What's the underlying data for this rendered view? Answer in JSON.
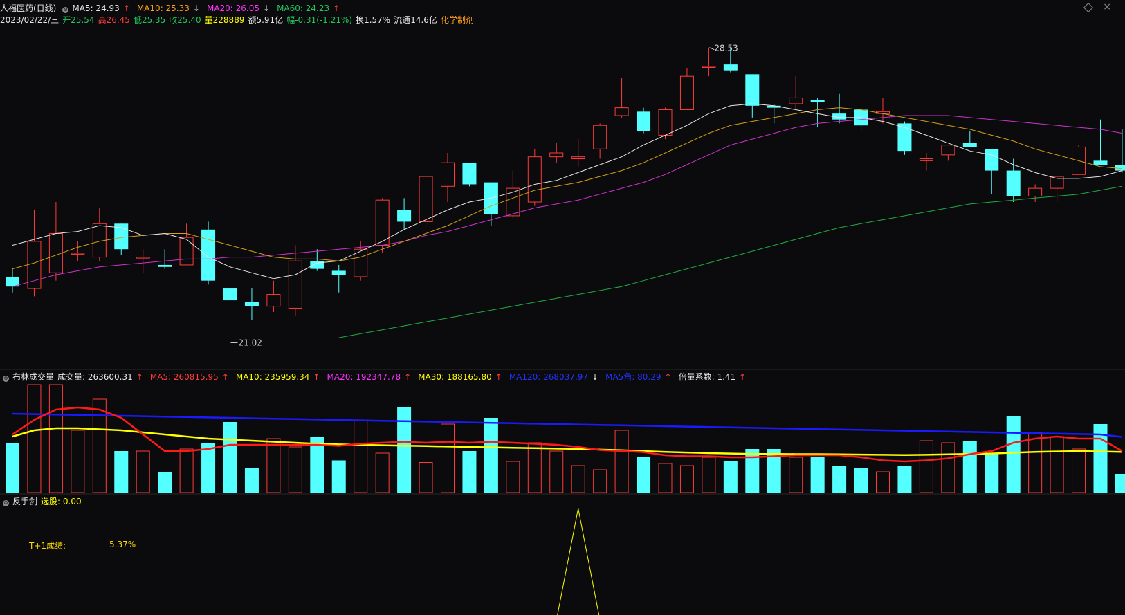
{
  "header": {
    "name": "人福医药(日线)",
    "ma5": "MA5: 24.93",
    "ma5_arrow": "↑",
    "ma10": "MA10: 25.33",
    "ma10_arrow": "↓",
    "ma20": "MA20: 26.05",
    "ma20_arrow": "↓",
    "ma60": "MA60: 24.23",
    "ma60_arrow": "↑",
    "date": "2023/02/22/三",
    "open": "开25.54",
    "high": "高26.45",
    "low": "低25.35",
    "close": "收25.40",
    "volume": "量228889",
    "amount": "额5.91亿",
    "change": "幅-0.31(-1.21%)",
    "turnover": "换1.57%",
    "float": "流通14.6亿",
    "sector": "化学制剂"
  },
  "volume_header": {
    "name": "布林成交量",
    "vol": "成交量: 263600.31",
    "vol_arrow": "↑",
    "ma5": "MA5: 260815.95",
    "ma5_arrow": "↑",
    "ma10": "MA10: 235959.34",
    "ma10_arrow": "↑",
    "ma20": "MA20: 192347.78",
    "ma20_arrow": "↑",
    "ma30": "MA30: 188165.80",
    "ma30_arrow": "↑",
    "ma120": "MA120: 268037.97",
    "ma120_arrow": "↓",
    "ma5angle": "MA5角: 80.29",
    "ma5angle_arrow": "↑",
    "ratio": "倍量系数: 1.41",
    "ratio_arrow": "↑"
  },
  "indicator_header": {
    "name": "反手剑",
    "pick": "选股: 0.00"
  },
  "stats": {
    "t1_label": "T+1成绩:",
    "t1_value": "5.37%"
  },
  "annotations": {
    "high_label": "28.53",
    "low_label": "21.02"
  },
  "colors": {
    "up": "#ff3b3b",
    "down": "#54ffff",
    "ma5": "#e6e6e6",
    "ma10": "#d4a017",
    "ma20": "#cc33cc",
    "ma60": "#22aa44",
    "vol_ma5": "#ff1a1a",
    "vol_ma10": "#ffff00",
    "vol_ma20": "#cc33cc",
    "vol_ma120": "#1a1aff",
    "signal": "#ffff00"
  },
  "chart_data": [
    {
      "type": "candlestick",
      "y_range": [
        20.5,
        29.0
      ],
      "candles": [
        {
          "o": 22.7,
          "h": 22.9,
          "l": 22.3,
          "c": 22.45
        },
        {
          "o": 22.4,
          "h": 24.4,
          "l": 22.2,
          "c": 23.6
        },
        {
          "o": 22.8,
          "h": 24.6,
          "l": 22.6,
          "c": 23.8
        },
        {
          "o": 23.3,
          "h": 23.6,
          "l": 23.1,
          "c": 23.3
        },
        {
          "o": 23.2,
          "h": 24.45,
          "l": 23.1,
          "c": 24.05
        },
        {
          "o": 24.05,
          "h": 24.05,
          "l": 23.25,
          "c": 23.4
        },
        {
          "o": 23.2,
          "h": 23.4,
          "l": 22.8,
          "c": 23.2
        },
        {
          "o": 23.0,
          "h": 23.4,
          "l": 22.9,
          "c": 22.95
        },
        {
          "o": 23.0,
          "h": 24.05,
          "l": 23.0,
          "c": 23.7
        },
        {
          "o": 23.9,
          "h": 24.1,
          "l": 22.5,
          "c": 22.6
        },
        {
          "o": 22.4,
          "h": 22.7,
          "l": 21.02,
          "c": 22.1
        },
        {
          "o": 22.05,
          "h": 22.4,
          "l": 21.6,
          "c": 21.95
        },
        {
          "o": 21.95,
          "h": 22.6,
          "l": 21.8,
          "c": 22.25
        },
        {
          "o": 21.9,
          "h": 23.5,
          "l": 21.7,
          "c": 23.1
        },
        {
          "o": 23.1,
          "h": 23.4,
          "l": 22.85,
          "c": 22.9
        },
        {
          "o": 22.85,
          "h": 23.0,
          "l": 22.3,
          "c": 22.75
        },
        {
          "o": 22.7,
          "h": 23.6,
          "l": 22.6,
          "c": 23.4
        },
        {
          "o": 23.5,
          "h": 24.7,
          "l": 23.3,
          "c": 24.65
        },
        {
          "o": 24.4,
          "h": 24.7,
          "l": 23.9,
          "c": 24.1
        },
        {
          "o": 24.1,
          "h": 25.35,
          "l": 23.95,
          "c": 25.25
        },
        {
          "o": 25.0,
          "h": 25.85,
          "l": 24.6,
          "c": 25.6
        },
        {
          "o": 25.6,
          "h": 25.6,
          "l": 25.0,
          "c": 25.05
        },
        {
          "o": 25.1,
          "h": 25.1,
          "l": 24.0,
          "c": 24.3
        },
        {
          "o": 24.25,
          "h": 25.4,
          "l": 24.2,
          "c": 24.95
        },
        {
          "o": 24.6,
          "h": 25.95,
          "l": 24.5,
          "c": 25.75
        },
        {
          "o": 25.75,
          "h": 26.1,
          "l": 25.6,
          "c": 25.85
        },
        {
          "o": 25.7,
          "h": 26.2,
          "l": 25.5,
          "c": 25.75
        },
        {
          "o": 25.95,
          "h": 26.6,
          "l": 25.7,
          "c": 26.55
        },
        {
          "o": 26.8,
          "h": 27.75,
          "l": 26.75,
          "c": 27.0
        },
        {
          "o": 26.9,
          "h": 27.0,
          "l": 26.35,
          "c": 26.4
        },
        {
          "o": 26.3,
          "h": 27.0,
          "l": 26.2,
          "c": 26.95
        },
        {
          "o": 26.95,
          "h": 28.0,
          "l": 26.95,
          "c": 27.8
        },
        {
          "o": 28.05,
          "h": 28.53,
          "l": 27.8,
          "c": 28.05
        },
        {
          "o": 28.1,
          "h": 28.53,
          "l": 27.9,
          "c": 27.95
        },
        {
          "o": 27.85,
          "h": 27.85,
          "l": 26.75,
          "c": 27.05
        },
        {
          "o": 27.05,
          "h": 27.1,
          "l": 26.6,
          "c": 27.0
        },
        {
          "o": 27.1,
          "h": 27.8,
          "l": 26.95,
          "c": 27.25
        },
        {
          "o": 27.2,
          "h": 27.25,
          "l": 26.5,
          "c": 27.15
        },
        {
          "o": 26.85,
          "h": 27.35,
          "l": 26.6,
          "c": 26.7
        },
        {
          "o": 26.95,
          "h": 27.0,
          "l": 26.4,
          "c": 26.55
        },
        {
          "o": 26.85,
          "h": 27.25,
          "l": 26.6,
          "c": 26.9
        },
        {
          "o": 26.6,
          "h": 26.65,
          "l": 25.8,
          "c": 25.9
        },
        {
          "o": 25.65,
          "h": 25.85,
          "l": 25.4,
          "c": 25.7
        },
        {
          "o": 25.8,
          "h": 26.0,
          "l": 25.65,
          "c": 26.05
        },
        {
          "o": 26.1,
          "h": 26.4,
          "l": 26.0,
          "c": 26.0
        },
        {
          "o": 25.95,
          "h": 25.95,
          "l": 24.8,
          "c": 25.4
        },
        {
          "o": 25.4,
          "h": 25.7,
          "l": 24.6,
          "c": 24.75
        },
        {
          "o": 24.75,
          "h": 25.05,
          "l": 24.6,
          "c": 24.95
        },
        {
          "o": 24.95,
          "h": 25.2,
          "l": 24.6,
          "c": 25.25
        },
        {
          "o": 25.3,
          "h": 26.05,
          "l": 25.3,
          "c": 26.0
        },
        {
          "o": 25.65,
          "h": 26.7,
          "l": 25.55,
          "c": 25.55
        },
        {
          "o": 25.54,
          "h": 26.45,
          "l": 25.35,
          "c": 25.4
        }
      ],
      "ma5": [
        23.5,
        23.65,
        23.8,
        23.85,
        24.0,
        23.95,
        23.75,
        23.8,
        23.65,
        23.2,
        22.95,
        22.8,
        22.65,
        22.75,
        23.05,
        23.1,
        23.35,
        23.6,
        23.9,
        24.15,
        24.4,
        24.6,
        24.7,
        24.85,
        25.05,
        25.15,
        25.35,
        25.55,
        25.75,
        26.05,
        26.3,
        26.55,
        26.85,
        27.05,
        27.1,
        27.05,
        26.95,
        26.85,
        26.75,
        26.75,
        26.65,
        26.5,
        26.3,
        26.1,
        25.9,
        25.8,
        25.55,
        25.35,
        25.2,
        25.2,
        25.25,
        25.4
      ],
      "ma10": [
        22.9,
        23.05,
        23.25,
        23.45,
        23.6,
        23.7,
        23.75,
        23.8,
        23.8,
        23.65,
        23.5,
        23.35,
        23.2,
        23.15,
        23.15,
        23.1,
        23.2,
        23.4,
        23.6,
        23.8,
        24.0,
        24.25,
        24.5,
        24.7,
        24.9,
        25.0,
        25.1,
        25.25,
        25.4,
        25.6,
        25.85,
        26.1,
        26.35,
        26.55,
        26.65,
        26.75,
        26.85,
        26.95,
        27.0,
        26.95,
        26.85,
        26.75,
        26.65,
        26.55,
        26.45,
        26.3,
        26.15,
        25.95,
        25.8,
        25.65,
        25.5,
        25.45
      ],
      "ma20": [
        22.45,
        22.6,
        22.75,
        22.85,
        22.95,
        23.0,
        23.05,
        23.1,
        23.15,
        23.15,
        23.2,
        23.2,
        23.25,
        23.3,
        23.35,
        23.4,
        23.45,
        23.5,
        23.6,
        23.75,
        23.85,
        24.0,
        24.15,
        24.3,
        24.45,
        24.55,
        24.65,
        24.8,
        24.95,
        25.1,
        25.3,
        25.55,
        25.8,
        26.05,
        26.2,
        26.35,
        26.5,
        26.6,
        26.65,
        26.7,
        26.75,
        26.8,
        26.8,
        26.8,
        26.75,
        26.7,
        26.65,
        26.6,
        26.55,
        26.5,
        26.45,
        26.35
      ],
      "ma60": [
        null,
        null,
        null,
        null,
        null,
        null,
        null,
        null,
        null,
        null,
        null,
        null,
        null,
        null,
        null,
        21.15,
        21.25,
        21.35,
        21.45,
        21.55,
        21.65,
        21.75,
        21.85,
        21.95,
        22.05,
        22.15,
        22.25,
        22.35,
        22.45,
        22.6,
        22.75,
        22.9,
        23.05,
        23.2,
        23.35,
        23.5,
        23.65,
        23.8,
        23.95,
        24.05,
        24.15,
        24.25,
        24.35,
        24.45,
        24.55,
        24.6,
        24.65,
        24.7,
        24.75,
        24.8,
        24.9,
        25.0
      ]
    },
    {
      "type": "bar",
      "name": "布林成交量",
      "y_range": [
        0,
        520000
      ],
      "volumes": [
        240000,
        520000,
        520000,
        300000,
        450000,
        200000,
        200000,
        100000,
        210000,
        240000,
        340000,
        120000,
        260000,
        220000,
        270000,
        155000,
        350000,
        190000,
        410000,
        145000,
        330000,
        200000,
        360000,
        150000,
        240000,
        200000,
        130000,
        110000,
        300000,
        170000,
        140000,
        130000,
        170000,
        150000,
        210000,
        210000,
        170000,
        170000,
        130000,
        120000,
        100000,
        130000,
        250000,
        240000,
        250000,
        190000,
        370000,
        290000,
        270000,
        210000,
        330000,
        90000
      ],
      "ma5": [
        280000,
        350000,
        400000,
        410000,
        400000,
        360000,
        280000,
        200000,
        200000,
        210000,
        230000,
        230000,
        230000,
        230000,
        230000,
        225000,
        235000,
        240000,
        245000,
        240000,
        245000,
        240000,
        245000,
        240000,
        235000,
        230000,
        220000,
        205000,
        200000,
        195000,
        180000,
        175000,
        175000,
        170000,
        170000,
        175000,
        180000,
        180000,
        180000,
        170000,
        155000,
        150000,
        155000,
        165000,
        185000,
        200000,
        240000,
        260000,
        270000,
        260000,
        260000,
        200000
      ],
      "ma10": [
        270000,
        300000,
        310000,
        310000,
        305000,
        300000,
        290000,
        280000,
        270000,
        260000,
        255000,
        250000,
        245000,
        240000,
        235000,
        232000,
        230000,
        228000,
        226000,
        224000,
        222000,
        220000,
        218000,
        216000,
        214000,
        212000,
        210000,
        207000,
        204000,
        200000,
        196000,
        193000,
        190000,
        188000,
        186000,
        186000,
        185000,
        185000,
        184000,
        183000,
        182000,
        181000,
        182000,
        184000,
        186000,
        188000,
        192000,
        196000,
        198000,
        200000,
        198000,
        196000
      ],
      "ma120": [
        380000,
        378000,
        376000,
        374000,
        372000,
        370000,
        368000,
        366000,
        364000,
        362000,
        360000,
        358000,
        356000,
        354000,
        352000,
        350000,
        348000,
        346000,
        344000,
        342000,
        340000,
        338000,
        336000,
        334000,
        332000,
        330000,
        328000,
        326000,
        324000,
        322000,
        320000,
        318000,
        316000,
        314000,
        312000,
        310000,
        308000,
        306000,
        304000,
        302000,
        300000,
        298000,
        296000,
        294000,
        292000,
        290000,
        288000,
        286000,
        284000,
        282000,
        280000,
        268000
      ]
    },
    {
      "type": "line",
      "name": "反手剑",
      "y_range": [
        0,
        1
      ],
      "signal": [
        0,
        0,
        0,
        0,
        0,
        0,
        0,
        0,
        0,
        0,
        0,
        0,
        0,
        0,
        0,
        0,
        0,
        0,
        0,
        0,
        0,
        0,
        0,
        0,
        0,
        0,
        1,
        0,
        0,
        0,
        0,
        0,
        0,
        0,
        0,
        0,
        0,
        0,
        0,
        0,
        0,
        0,
        0,
        0,
        0,
        0,
        0,
        0,
        0,
        0,
        0,
        0
      ]
    }
  ]
}
